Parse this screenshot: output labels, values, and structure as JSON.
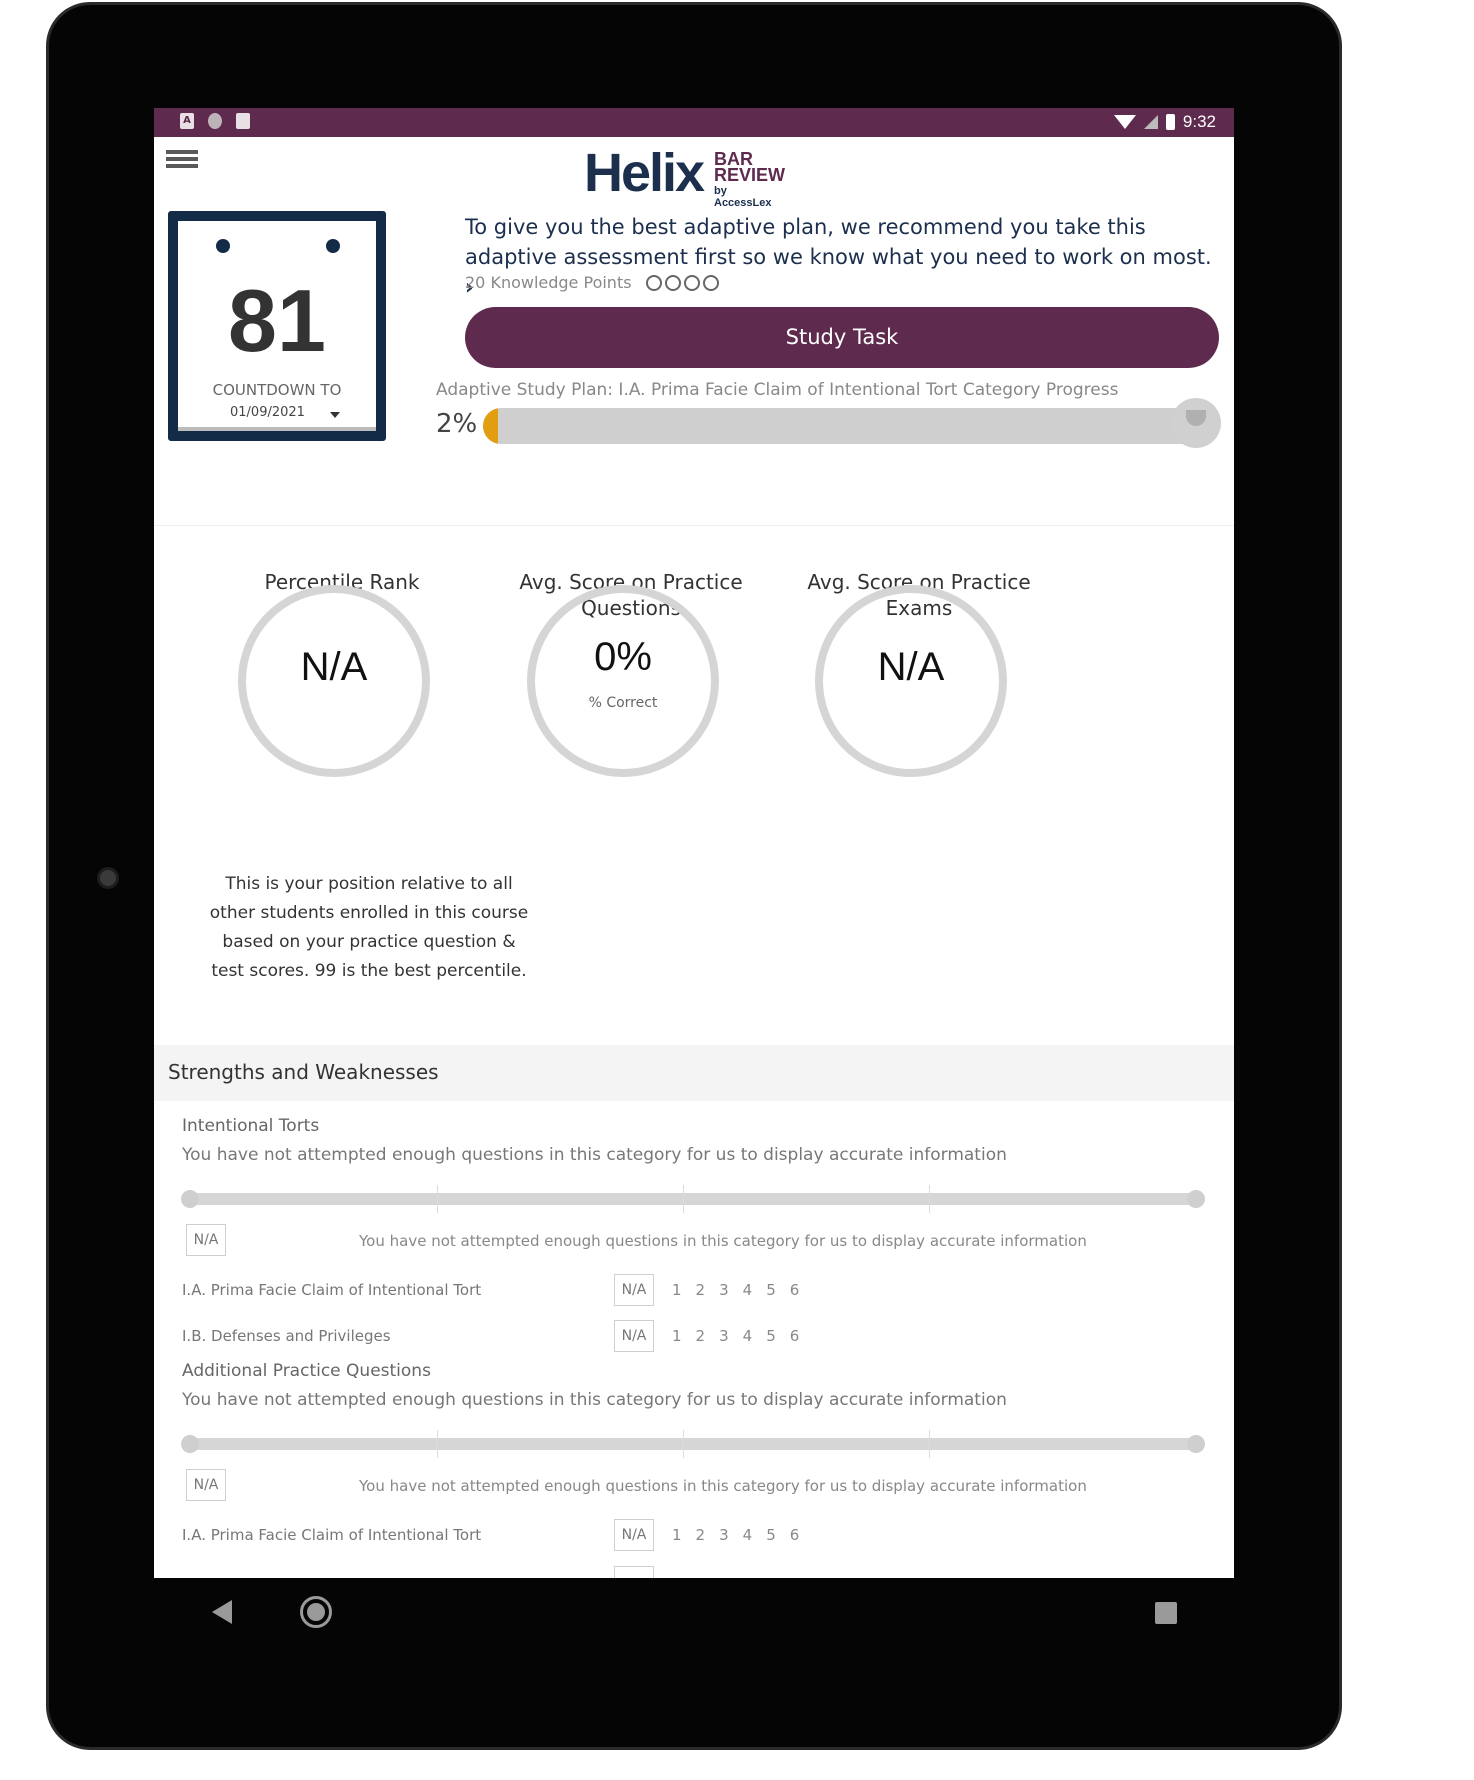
{
  "status_bar": {
    "time": "9:32",
    "left_icons": [
      "A",
      "",
      ""
    ]
  },
  "header": {
    "logo_main": "Helix",
    "logo_bar": "BAR",
    "logo_review": "REVIEW",
    "logo_by": "by AccessLex"
  },
  "countdown": {
    "days": "81",
    "label": "COUNTDOWN TO",
    "date": "01/09/2021"
  },
  "recommendation": {
    "text": "To give you the best adaptive plan, we recommend you take this adaptive assessment first so we know what you need to work on most.",
    "chevron": "›",
    "knowledge_points": "20 Knowledge Points"
  },
  "study_task": {
    "label": "Study Task"
  },
  "plan": {
    "label": "Adaptive Study Plan: I.A. Prima Facie Claim of Intentional Tort Category Progress",
    "percent_text": "2%",
    "progress": 0.02
  },
  "metrics": [
    {
      "title": "Percentile Rank",
      "value": "N/A",
      "sub": ""
    },
    {
      "title": "Avg. Score on Practice Questions",
      "value": "0%",
      "sub": "% Correct"
    },
    {
      "title": "Avg. Score on Practice Exams",
      "value": "N/A",
      "sub": ""
    }
  ],
  "percentile_desc": "This is your position relative to all other students enrolled in this course based on your practice question & test scores. 99 is the best percentile.",
  "strengths": {
    "title": "Strengths and Weaknesses",
    "categories": [
      {
        "title": "Intentional Torts",
        "note": "You have not attempted enough questions in this category for us to display accurate information",
        "na": "N/A",
        "na_note": "You have not attempted enough questions in this category for us to display accurate information",
        "subs": [
          {
            "name": "I.A. Prima Facie Claim of Intentional Tort",
            "na": "N/A",
            "nums": [
              "1",
              "2",
              "3",
              "4",
              "5",
              "6"
            ]
          },
          {
            "name": "I.B. Defenses and Privileges",
            "na": "N/A",
            "nums": [
              "1",
              "2",
              "3",
              "4",
              "5",
              "6"
            ]
          }
        ]
      },
      {
        "title": "Additional Practice Questions",
        "note": "You have not attempted enough questions in this category for us to display accurate information",
        "na": "N/A",
        "na_note": "You have not attempted enough questions in this category for us to display accurate information",
        "subs": [
          {
            "name": "I.A. Prima Facie Claim of Intentional Tort",
            "na": "N/A",
            "nums": [
              "1",
              "2",
              "3",
              "4",
              "5",
              "6"
            ]
          }
        ]
      }
    ]
  },
  "colors": {
    "brand": "#5e2a4d",
    "navy": "#142b48",
    "progress": "#e09e10"
  }
}
